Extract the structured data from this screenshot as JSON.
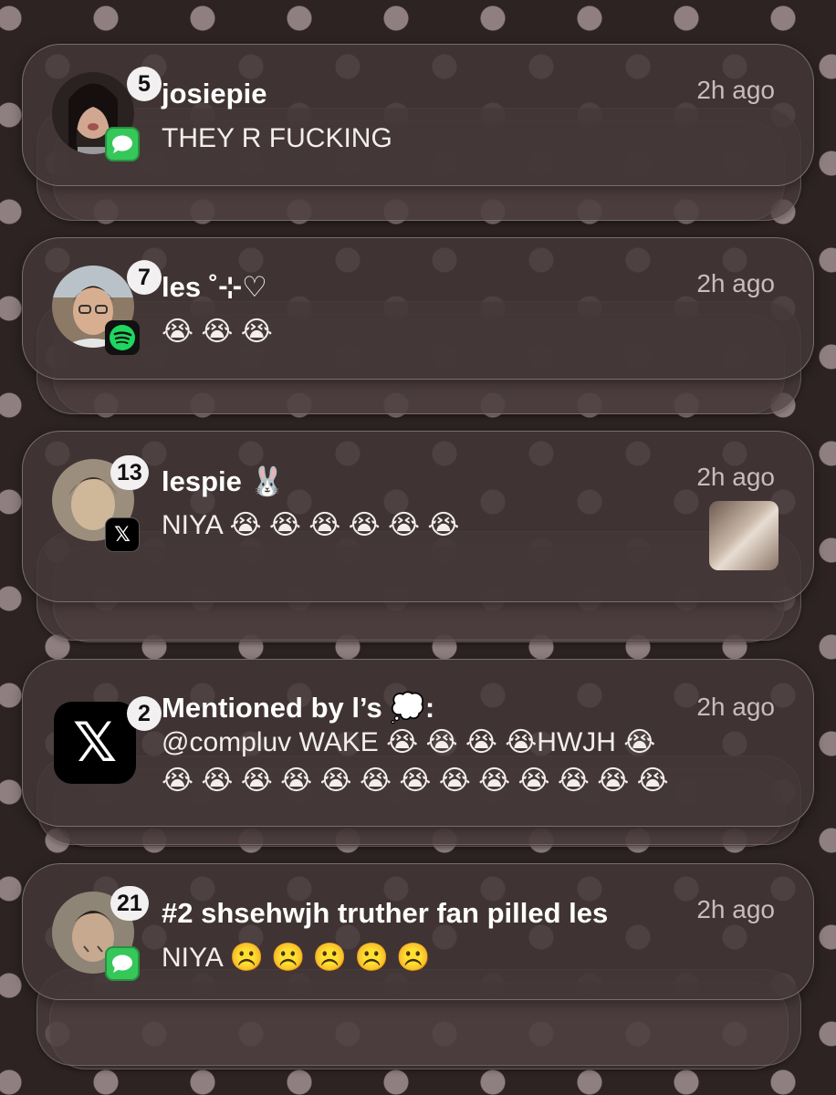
{
  "notifications": [
    {
      "sender": "josiepie",
      "message": "THEY R FUCKING",
      "time": "2h ago",
      "count": "5",
      "app": "messages",
      "app_icon": "message-bubble-icon"
    },
    {
      "sender": "les ˚⊹♡",
      "message": "😭 😭 😭",
      "time": "2h ago",
      "count": "7",
      "app": "spotify",
      "app_icon": "spotify-icon"
    },
    {
      "sender": "lespie 🐰",
      "message": "NIYA 😭 😭 😭 😭 😭 😭",
      "time": "2h ago",
      "count": "13",
      "app": "x",
      "app_icon": "x-logo-icon"
    },
    {
      "sender": "Mentioned by l’s 💭:",
      "message_line1": "@compluv WAKE 😭 😭 😭 😭HWJH 😭",
      "message_line2": "😭 😭 😭 😭 😭 😭 😭 😭 😭 😭 😭 😭 😭",
      "time": "2h ago",
      "count": "2",
      "app": "x",
      "app_icon": "x-logo-icon",
      "app_glyph": "𝕏"
    },
    {
      "sender": "#2 shsehwjh truther fan pilled les",
      "message": "NIYA ☹️ ☹️ ☹️ ☹️ ☹️",
      "time": "2h ago",
      "count": "21",
      "app": "messages",
      "app_icon": "message-bubble-icon"
    }
  ],
  "colors": {
    "background": "#2c2322",
    "dots": "#8f7f80",
    "messages_green": "#36c759",
    "spotify_green": "#1ed760"
  }
}
